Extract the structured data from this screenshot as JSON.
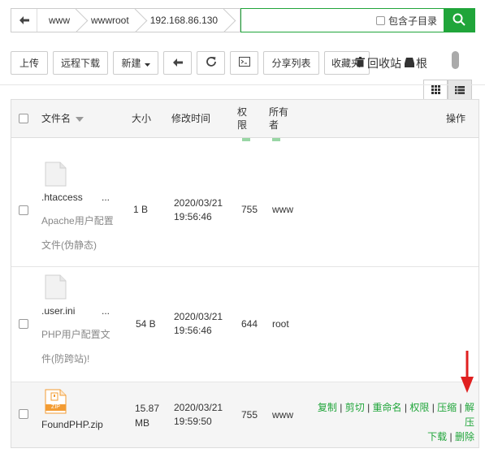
{
  "breadcrumb": {
    "back_icon": "arrow-left-icon",
    "items": [
      "www",
      "wwwroot",
      "192.168.86.130"
    ]
  },
  "search": {
    "value": "",
    "placeholder": "",
    "include_subdir_label": "包含子目录",
    "button_icon": "search-icon"
  },
  "toolbar": {
    "upload": "上传",
    "remote_download": "远程下载",
    "new": "新建",
    "back_icon": "arrow-left-icon",
    "refresh_icon": "refresh-icon",
    "terminal_icon": "terminal-icon",
    "share_list": "分享列表",
    "favorites": "收藏夹",
    "recycle_bin": "回收站",
    "root": "根"
  },
  "view_modes": {
    "grid_icon": "grid-icon",
    "list_icon": "list-icon",
    "active": "list"
  },
  "table": {
    "headers": {
      "name": "文件名",
      "size": "大小",
      "mtime": "修改时间",
      "perm": "权限",
      "owner": "所有者",
      "actions": "操作"
    },
    "rows": [
      {
        "name": ".htaccess",
        "ellipsis": "...",
        "desc": "Apache用户配置文件(伪静态)",
        "size": "1 B",
        "date": "2020/03/21",
        "time": "19:56:46",
        "perm": "755",
        "owner": "www",
        "icon": "file-icon"
      },
      {
        "name": ".user.ini",
        "ellipsis": "...",
        "desc": "PHP用户配置文件(防跨站)!",
        "size": "54 B",
        "date": "2020/03/21",
        "time": "19:56:46",
        "perm": "644",
        "owner": "root",
        "icon": "file-icon"
      },
      {
        "name": "FoundPHP.zip",
        "size": "15.87 MB",
        "date": "2020/03/21",
        "time": "19:59:50",
        "perm": "755",
        "owner": "www",
        "icon": "zip-file-icon",
        "icon_label": "ZIP",
        "actions": [
          "复制",
          "剪切",
          "重命名",
          "权限",
          "压缩",
          "解压",
          "下载",
          "删除"
        ]
      }
    ]
  },
  "colors": {
    "accent": "#20a53a",
    "arrow": "#e02020",
    "zip": "#f39c33"
  }
}
